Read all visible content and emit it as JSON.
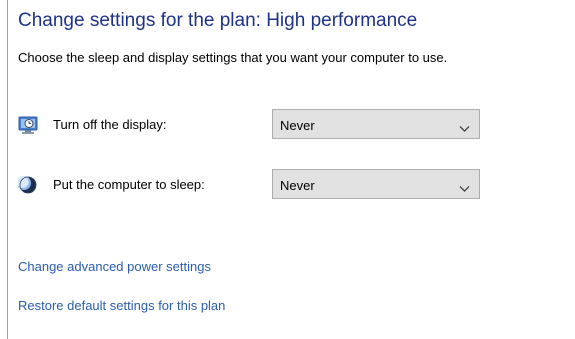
{
  "header": {
    "title": "Change settings for the plan: High performance",
    "subtitle": "Choose the sleep and display settings that you want your computer to use."
  },
  "settings": [
    {
      "label": "Turn off the display:",
      "icon": "display-icon",
      "selected": "Never"
    },
    {
      "label": "Put the computer to sleep:",
      "icon": "sleep-moon-icon",
      "selected": "Never"
    }
  ],
  "links": {
    "advanced": "Change advanced power settings",
    "restore": "Restore default settings for this plan"
  },
  "colors": {
    "title": "#1e3287",
    "link": "#2a5db0",
    "select_bg": "#e1e1e1",
    "select_border": "#adadad"
  }
}
